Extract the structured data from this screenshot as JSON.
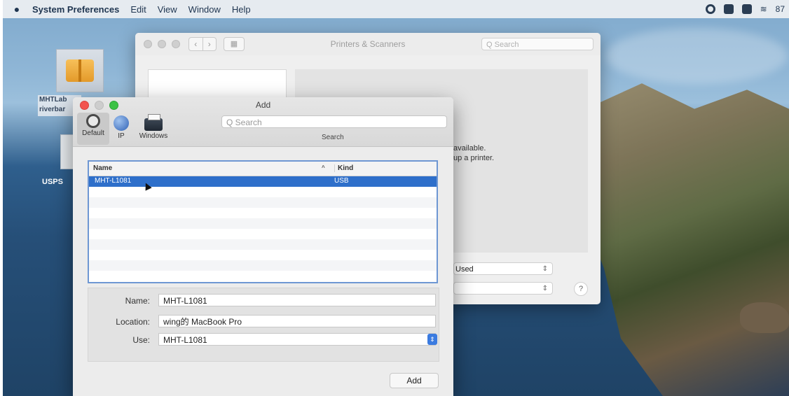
{
  "menubar": {
    "app_name": "System Preferences",
    "items": [
      "Edit",
      "View",
      "Window",
      "Help"
    ],
    "status_text": "87"
  },
  "desktop": {
    "icon1_label": "MHTLab riverbar",
    "icon2_label": "USPS"
  },
  "printers_window": {
    "title": "Printers & Scanners",
    "search_placeholder": "Q Search",
    "message_line1": "available.",
    "message_line2": "up a printer.",
    "select1_value": "Used",
    "select2_value": "",
    "help_label": "?"
  },
  "add_dialog": {
    "title": "Add",
    "toolbar": {
      "default_label": "Default",
      "ip_label": "IP",
      "windows_label": "Windows"
    },
    "search_placeholder": "Q Search",
    "search_label": "Search",
    "table": {
      "col_name": "Name",
      "col_kind": "Kind",
      "sort_indicator": "^",
      "rows": [
        {
          "name": "MHT-L1081",
          "kind": "USB",
          "selected": true
        }
      ]
    },
    "form": {
      "name_label": "Name:",
      "name_value": "MHT-L1081",
      "location_label": "Location:",
      "location_value": "wing的 MacBook Pro",
      "use_label": "Use:",
      "use_value": "MHT-L1081"
    },
    "add_button": "Add"
  },
  "colors": {
    "selection": "#2e6fca",
    "table_border": "#6e97d3",
    "close": "#f2544e",
    "zoom": "#3cc245"
  }
}
